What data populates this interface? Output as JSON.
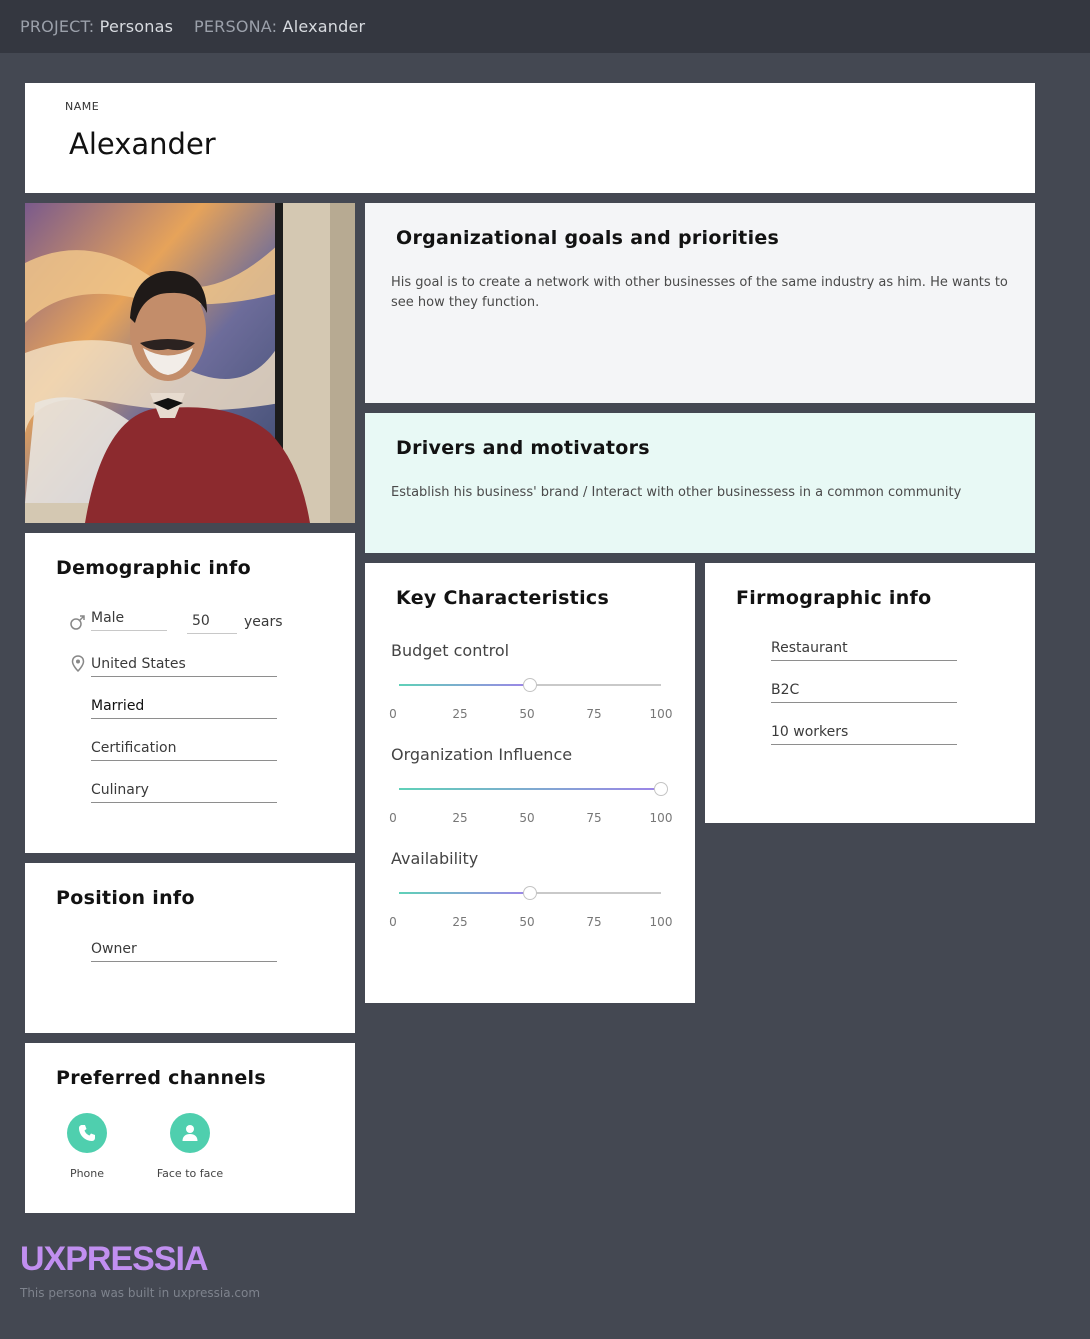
{
  "header": {
    "project_label": "PROJECT:",
    "project_value": "Personas",
    "persona_label": "PERSONA:",
    "persona_value": "Alexander"
  },
  "name_card": {
    "label": "NAME",
    "value": "Alexander"
  },
  "goals": {
    "title": "Organizational goals and priorities",
    "text": "His goal is to create a network with other businesses of the same industry as him. He wants to see how they function."
  },
  "drivers": {
    "title": "Drivers and motivators",
    "text": "Establish his business' brand / Interact with other businessess in a common community"
  },
  "demographic": {
    "title": "Demographic info",
    "gender": "Male",
    "age": "50",
    "age_unit": "years",
    "location": "United States",
    "marital_status": "Married",
    "education": "Certification",
    "field": "Culinary"
  },
  "key_characteristics": {
    "title": "Key Characteristics",
    "ticks": [
      "0",
      "25",
      "50",
      "75",
      "100"
    ],
    "sliders": [
      {
        "label": "Budget control",
        "value": 50
      },
      {
        "label": "Organization Influence",
        "value": 100
      },
      {
        "label": "Availability",
        "value": 50
      }
    ]
  },
  "firmographic": {
    "title": "Firmographic info",
    "industry": "Restaurant",
    "business_type": "B2C",
    "company_size": "10 workers"
  },
  "position": {
    "title": "Position info",
    "role": "Owner"
  },
  "channels": {
    "title": "Preferred channels",
    "items": [
      {
        "label": "Phone",
        "icon": "phone-icon"
      },
      {
        "label": "Face to face",
        "icon": "person-icon"
      }
    ]
  },
  "branding": {
    "logo": "UXPRESSIA",
    "footer": "This persona was built in uxpressia.com"
  },
  "colors": {
    "background": "#444852",
    "topbar": "#343740",
    "accent_green": "#4fcfae",
    "accent_purple": "#9d84e8",
    "logo": "#c18ff0",
    "drivers_bg": "#e8f9f5",
    "goals_bg": "#f4f5f7"
  }
}
